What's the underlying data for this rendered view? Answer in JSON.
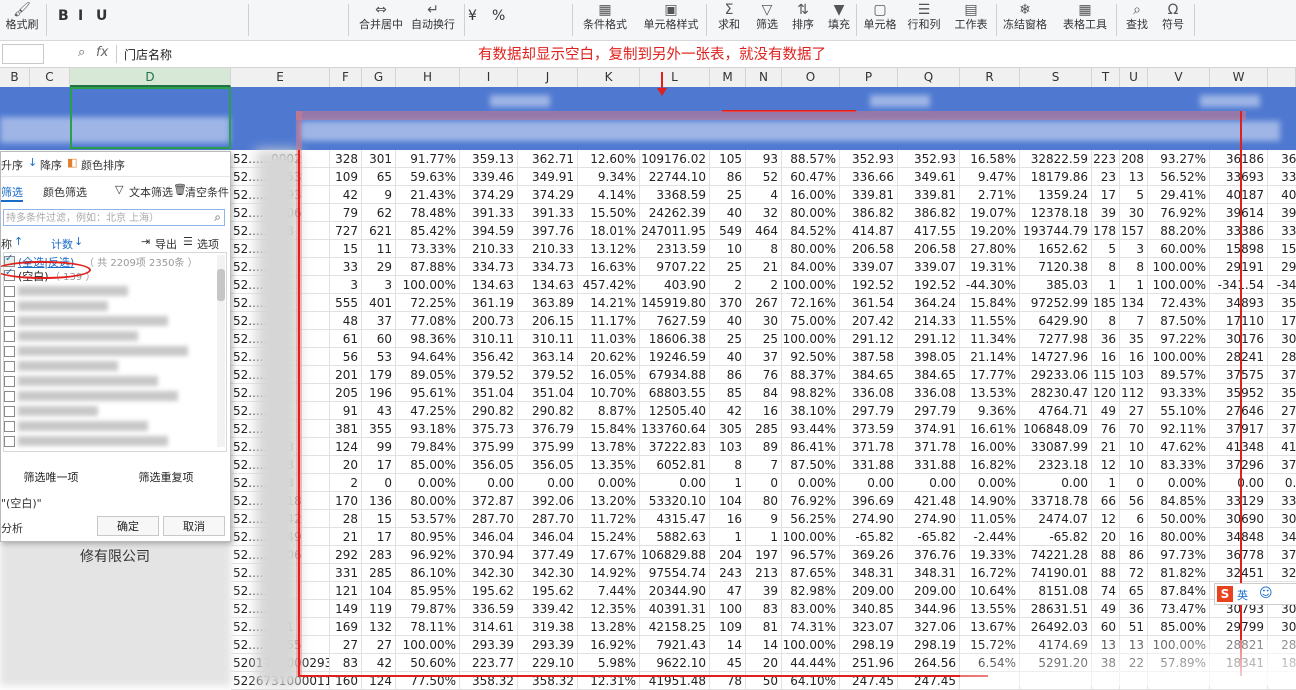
{
  "ribbon": {
    "groups": [
      {
        "name": "format-painter",
        "label": "格式刷",
        "icon": "🖌"
      },
      {
        "name": "merge-center",
        "label": "合并居中",
        "icon": "⇔"
      },
      {
        "name": "wrap-text",
        "label": "自动换行",
        "icon": "↵"
      },
      {
        "name": "conditional-format",
        "label": "条件格式",
        "icon": "▦"
      },
      {
        "name": "cell-style",
        "label": "单元格样式",
        "icon": "▣"
      },
      {
        "name": "sum",
        "label": "求和",
        "icon": "Σ"
      },
      {
        "name": "filter",
        "label": "筛选",
        "icon": "▽"
      },
      {
        "name": "sort",
        "label": "排序",
        "icon": "⇅"
      },
      {
        "name": "fill",
        "label": "填充",
        "icon": "▼"
      },
      {
        "name": "cell",
        "label": "单元格",
        "icon": "▢"
      },
      {
        "name": "row-col",
        "label": "行和列",
        "icon": "☰"
      },
      {
        "name": "worksheet",
        "label": "工作表",
        "icon": "▤"
      },
      {
        "name": "freeze",
        "label": "冻结窗格",
        "icon": "❄"
      },
      {
        "name": "table-tools",
        "label": "表格工具",
        "icon": "▦"
      },
      {
        "name": "find",
        "label": "查找",
        "icon": "⌕"
      },
      {
        "name": "symbol",
        "label": "符号",
        "icon": "Ω"
      }
    ],
    "format_buttons": [
      "B",
      "I",
      "U"
    ],
    "number_format": [
      "¥",
      "%"
    ]
  },
  "formula_bar": {
    "fx": "fx",
    "value": "门店名称",
    "annotation": "有数据却显示空白，复制到另外一张表，就没有数据了"
  },
  "columns": [
    "B",
    "C",
    "D",
    "E",
    "F",
    "G",
    "H",
    "I",
    "J",
    "K",
    "L",
    "M",
    "N",
    "O",
    "P",
    "Q",
    "R",
    "S",
    "T",
    "U",
    "V",
    "W",
    ""
  ],
  "filter_panel": {
    "sort_asc": "升序",
    "sort_desc": "降序",
    "color_sort": "颜色排序",
    "tab_content": "筛选",
    "tab_color": "颜色筛选",
    "text_filter": "文本筛选",
    "clear": "清空条件",
    "search_placeholder": "持多条件过滤，例如：北京 上海）",
    "col_name": "称",
    "col_count": "计数",
    "export": "导出",
    "options": "选项",
    "select_all": "(全选|反选)",
    "select_all_count": "（ 共 2209项 2350条 ）",
    "blank": "(空白)",
    "blank_count": "（ 139 ）",
    "unique_btn": "筛选唯一项",
    "dup_btn": "筛选重复项",
    "condition": "\"(空白)\"",
    "analysis": "分析",
    "ok": "确定",
    "cancel": "取消"
  },
  "left_text": "修有限公司",
  "ime": {
    "logo": "S",
    "mode": "英",
    "extra": "·"
  },
  "rows": [
    [
      "52......0002",
      "328",
      "301",
      "91.77%",
      "359.13",
      "362.71",
      "12.60%",
      "109176.02",
      "105",
      "93",
      "88.57%",
      "352.93",
      "352.93",
      "16.58%",
      "32822.59",
      "223",
      "208",
      "93.27%",
      "36186",
      "367"
    ],
    [
      "52......0053",
      "109",
      "65",
      "59.63%",
      "339.46",
      "349.91",
      "9.34%",
      "22744.10",
      "86",
      "52",
      "60.47%",
      "336.66",
      "349.61",
      "9.47%",
      "18179.86",
      "23",
      "13",
      "56.52%",
      "33693",
      "336"
    ],
    [
      "52......0093",
      "42",
      "9",
      "21.43%",
      "374.29",
      "374.29",
      "4.14%",
      "3368.59",
      "25",
      "4",
      "16.00%",
      "339.81",
      "339.81",
      "2.71%",
      "1359.24",
      "17",
      "5",
      "29.41%",
      "40187",
      "401"
    ],
    [
      "52......0006",
      "79",
      "62",
      "78.48%",
      "391.33",
      "391.33",
      "15.50%",
      "24262.39",
      "40",
      "32",
      "80.00%",
      "386.82",
      "386.82",
      "19.07%",
      "12378.18",
      "39",
      "30",
      "76.92%",
      "39614",
      "396"
    ],
    [
      "52......528",
      "727",
      "621",
      "85.42%",
      "394.59",
      "397.76",
      "18.01%",
      "247011.95",
      "549",
      "464",
      "84.52%",
      "414.87",
      "417.55",
      "19.20%",
      "193744.79",
      "178",
      "157",
      "88.20%",
      "33386",
      "338"
    ],
    [
      "52......57",
      "15",
      "11",
      "73.33%",
      "210.33",
      "210.33",
      "13.12%",
      "2313.59",
      "10",
      "8",
      "80.00%",
      "206.58",
      "206.58",
      "27.80%",
      "1652.62",
      "5",
      "3",
      "60.00%",
      "15898",
      "158"
    ],
    [
      "52......7",
      "33",
      "29",
      "87.88%",
      "334.73",
      "334.73",
      "16.63%",
      "9707.22",
      "25",
      "21",
      "84.00%",
      "339.07",
      "339.07",
      "19.31%",
      "7120.38",
      "8",
      "8",
      "100.00%",
      "29191",
      "291"
    ],
    [
      "52......",
      "3",
      "3",
      "100.00%",
      "134.63",
      "134.63",
      "457.42%",
      "403.90",
      "2",
      "2",
      "100.00%",
      "192.52",
      "192.52",
      "-44.30%",
      "385.03",
      "1",
      "1",
      "100.00%",
      "-341.54",
      "-341"
    ],
    [
      "52......",
      "555",
      "401",
      "72.25%",
      "361.19",
      "363.89",
      "14.21%",
      "145919.80",
      "370",
      "267",
      "72.16%",
      "361.54",
      "364.24",
      "15.84%",
      "97252.99",
      "185",
      "134",
      "72.43%",
      "34893",
      "356"
    ],
    [
      "52......",
      "48",
      "37",
      "77.08%",
      "200.73",
      "206.15",
      "11.17%",
      "7627.59",
      "40",
      "30",
      "75.00%",
      "207.42",
      "214.33",
      "11.55%",
      "6429.90",
      "8",
      "7",
      "87.50%",
      "17110",
      "171"
    ],
    [
      "52......",
      "61",
      "60",
      "98.36%",
      "310.11",
      "310.11",
      "11.03%",
      "18606.38",
      "25",
      "25",
      "100.00%",
      "291.12",
      "291.12",
      "11.34%",
      "7277.98",
      "36",
      "35",
      "97.22%",
      "30176",
      "301"
    ],
    [
      "52......",
      "56",
      "53",
      "94.64%",
      "356.42",
      "363.14",
      "20.62%",
      "19246.59",
      "40",
      "37",
      "92.50%",
      "387.58",
      "398.05",
      "21.14%",
      "14727.96",
      "16",
      "16",
      "100.00%",
      "28241",
      "282"
    ],
    [
      "52......",
      "201",
      "179",
      "89.05%",
      "379.52",
      "379.52",
      "16.05%",
      "67934.88",
      "86",
      "76",
      "88.37%",
      "384.65",
      "384.65",
      "17.77%",
      "29233.06",
      "115",
      "103",
      "89.57%",
      "37575",
      "375"
    ],
    [
      "52......",
      "205",
      "196",
      "95.61%",
      "351.04",
      "351.04",
      "10.70%",
      "68803.55",
      "85",
      "84",
      "98.82%",
      "336.08",
      "336.08",
      "13.53%",
      "28230.47",
      "120",
      "112",
      "93.33%",
      "35952",
      "359"
    ],
    [
      "52......",
      "91",
      "43",
      "47.25%",
      "290.82",
      "290.82",
      "8.87%",
      "12505.40",
      "42",
      "16",
      "38.10%",
      "297.79",
      "297.79",
      "9.36%",
      "4764.71",
      "49",
      "27",
      "55.10%",
      "27646",
      "276"
    ],
    [
      "52......16",
      "381",
      "355",
      "93.18%",
      "375.73",
      "376.79",
      "15.84%",
      "133760.64",
      "305",
      "285",
      "93.44%",
      "373.59",
      "374.91",
      "16.61%",
      "106848.09",
      "76",
      "70",
      "92.11%",
      "37917",
      "379"
    ],
    [
      "52......133",
      "124",
      "99",
      "79.84%",
      "375.99",
      "375.99",
      "13.78%",
      "37222.83",
      "103",
      "89",
      "86.41%",
      "371.78",
      "371.78",
      "16.00%",
      "33087.99",
      "21",
      "10",
      "47.62%",
      "41348",
      "413"
    ],
    [
      "52......073",
      "20",
      "17",
      "85.00%",
      "356.05",
      "356.05",
      "13.35%",
      "6052.81",
      "8",
      "7",
      "87.50%",
      "331.88",
      "331.88",
      "16.82%",
      "2323.18",
      "12",
      "10",
      "83.33%",
      "37296",
      "372"
    ],
    [
      "52......053",
      "2",
      "0",
      "0.00%",
      "0.00",
      "0.00",
      "0.00%",
      "0.00",
      "1",
      "0",
      "0.00%",
      "0.00",
      "0.00",
      "0.00%",
      "0.00",
      "1",
      "0",
      "0.00%",
      "0.00",
      "0.0"
    ],
    [
      "52......0018",
      "170",
      "136",
      "80.00%",
      "372.87",
      "392.06",
      "13.20%",
      "53320.10",
      "104",
      "80",
      "76.92%",
      "396.69",
      "421.48",
      "14.90%",
      "33718.78",
      "66",
      "56",
      "84.85%",
      "33129",
      "331"
    ],
    [
      "52......0142",
      "28",
      "15",
      "53.57%",
      "287.70",
      "287.70",
      "11.72%",
      "4315.47",
      "16",
      "9",
      "56.25%",
      "274.90",
      "274.90",
      "11.05%",
      "2474.07",
      "12",
      "6",
      "50.00%",
      "30690",
      "306"
    ],
    [
      "52......0649",
      "21",
      "17",
      "80.95%",
      "346.04",
      "346.04",
      "15.24%",
      "5882.63",
      "1",
      "1",
      "100.00%",
      "-65.82",
      "-65.82",
      "-2.44%",
      "-65.82",
      "20",
      "16",
      "80.00%",
      "34848",
      "348"
    ],
    [
      "52......0006",
      "292",
      "283",
      "96.92%",
      "370.94",
      "377.49",
      "17.67%",
      "106829.88",
      "204",
      "197",
      "96.57%",
      "369.26",
      "376.76",
      "19.33%",
      "74221.28",
      "88",
      "86",
      "97.73%",
      "36778",
      "373"
    ],
    [
      "52......47",
      "331",
      "285",
      "86.10%",
      "342.30",
      "342.30",
      "14.92%",
      "97554.74",
      "243",
      "213",
      "87.65%",
      "348.31",
      "348.31",
      "16.72%",
      "74190.01",
      "88",
      "72",
      "81.82%",
      "32451",
      "324"
    ],
    [
      "52......71",
      "121",
      "104",
      "85.95%",
      "195.62",
      "195.62",
      "7.44%",
      "20344.90",
      "47",
      "39",
      "82.98%",
      "209.00",
      "209.00",
      "10.64%",
      "8151.08",
      "74",
      "65",
      "87.84%",
      "",
      "189"
    ],
    [
      "52......20",
      "149",
      "119",
      "79.87%",
      "336.59",
      "339.42",
      "12.35%",
      "40391.31",
      "100",
      "83",
      "83.00%",
      "340.85",
      "344.96",
      "13.55%",
      "28631.51",
      "49",
      "36",
      "73.47%",
      "30793",
      "307"
    ],
    [
      "52......761",
      "169",
      "132",
      "78.11%",
      "314.61",
      "319.38",
      "13.28%",
      "42158.25",
      "109",
      "81",
      "74.31%",
      "323.07",
      "327.06",
      "13.67%",
      "26492.03",
      "60",
      "51",
      "85.00%",
      "29799",
      "303"
    ],
    [
      "52......0655",
      "27",
      "27",
      "100.00%",
      "293.39",
      "293.39",
      "16.92%",
      "7921.43",
      "14",
      "14",
      "100.00%",
      "298.19",
      "298.19",
      "15.72%",
      "4174.69",
      "13",
      "13",
      "100.00%",
      "28821",
      "288"
    ],
    [
      "5201721000293",
      "83",
      "42",
      "50.60%",
      "223.77",
      "229.10",
      "5.98%",
      "9622.10",
      "45",
      "20",
      "44.44%",
      "251.96",
      "264.56",
      "6.54%",
      "5291.20",
      "38",
      "22",
      "57.89%",
      "18341",
      "183"
    ],
    [
      "5226731000011",
      "160",
      "124",
      "77.50%",
      "358.32",
      "358.32",
      "12.31%",
      "41951.48",
      "78",
      "50",
      "64.10%",
      "247.45",
      "247.45",
      "",
      "",
      "",
      "",
      "",
      "",
      ""
    ]
  ]
}
